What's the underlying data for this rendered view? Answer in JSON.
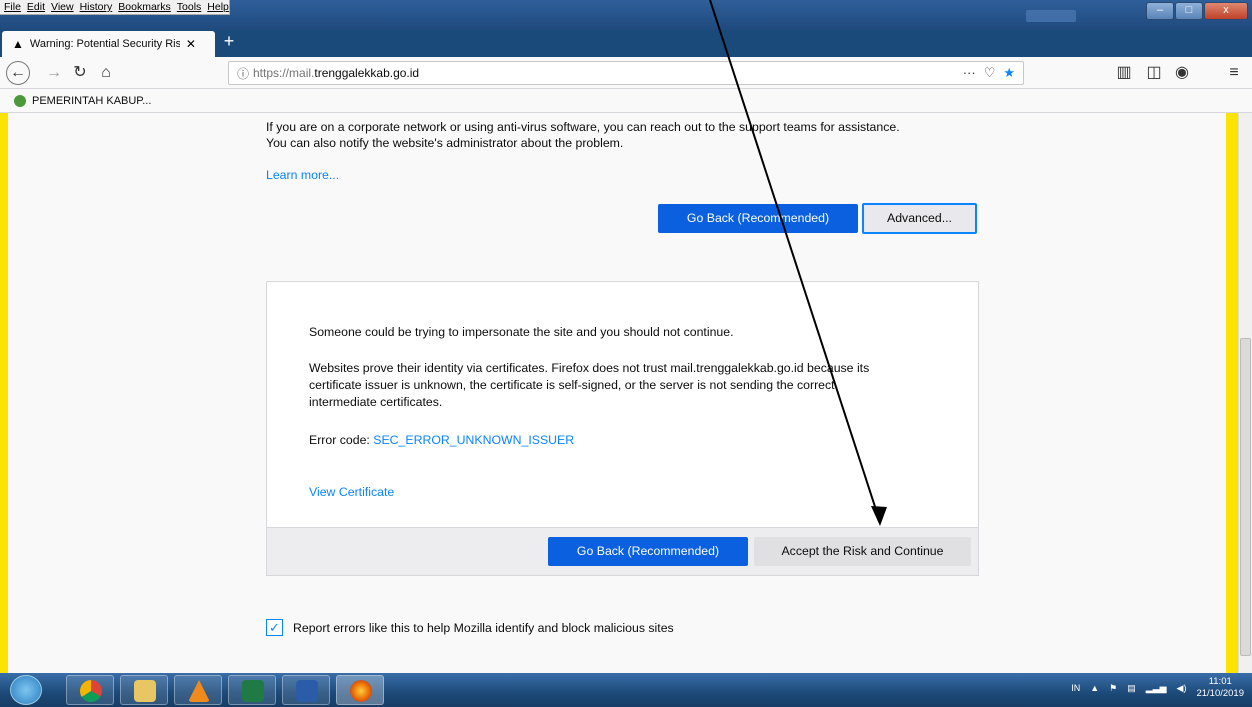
{
  "menu": [
    "File",
    "Edit",
    "View",
    "History",
    "Bookmarks",
    "Tools",
    "Help"
  ],
  "tab": {
    "title": "Warning: Potential Security Risk"
  },
  "newtab_label": "+",
  "window_controls": {
    "min": "–",
    "max": "□",
    "close": "x"
  },
  "url": {
    "prefix": "https://mail.",
    "host": "trenggalekkab.go.id"
  },
  "bookmark": {
    "label": "PEMERINTAH KABUP..."
  },
  "page": {
    "support_line1": "If you are on a corporate network or using anti-virus software, you can reach out to the support teams for assistance.",
    "support_line2": "You can also notify the website's administrator about the problem.",
    "learn_more": "Learn more...",
    "go_back": "Go Back (Recommended)",
    "advanced": "Advanced...",
    "adv_line1": "Someone could be trying to impersonate the site and you should not continue.",
    "adv_para_a": "Websites prove their identity via certificates. Firefox does not trust mail.trenggalekkab.go.id because its",
    "adv_para_b": "certificate issuer is unknown, the certificate is self-signed, or the server is not sending the correct",
    "adv_para_c": "intermediate certificates.",
    "error_label": "Error code:",
    "error_code": "SEC_ERROR_UNKNOWN_ISSUER",
    "view_cert": "View Certificate",
    "go_back_2": "Go Back (Recommended)",
    "accept": "Accept the Risk and Continue",
    "report": "Report errors like this to help Mozilla identify and block malicious sites"
  },
  "tray": {
    "lang": "IN",
    "time": "11:01",
    "date": "21/10/2019"
  }
}
